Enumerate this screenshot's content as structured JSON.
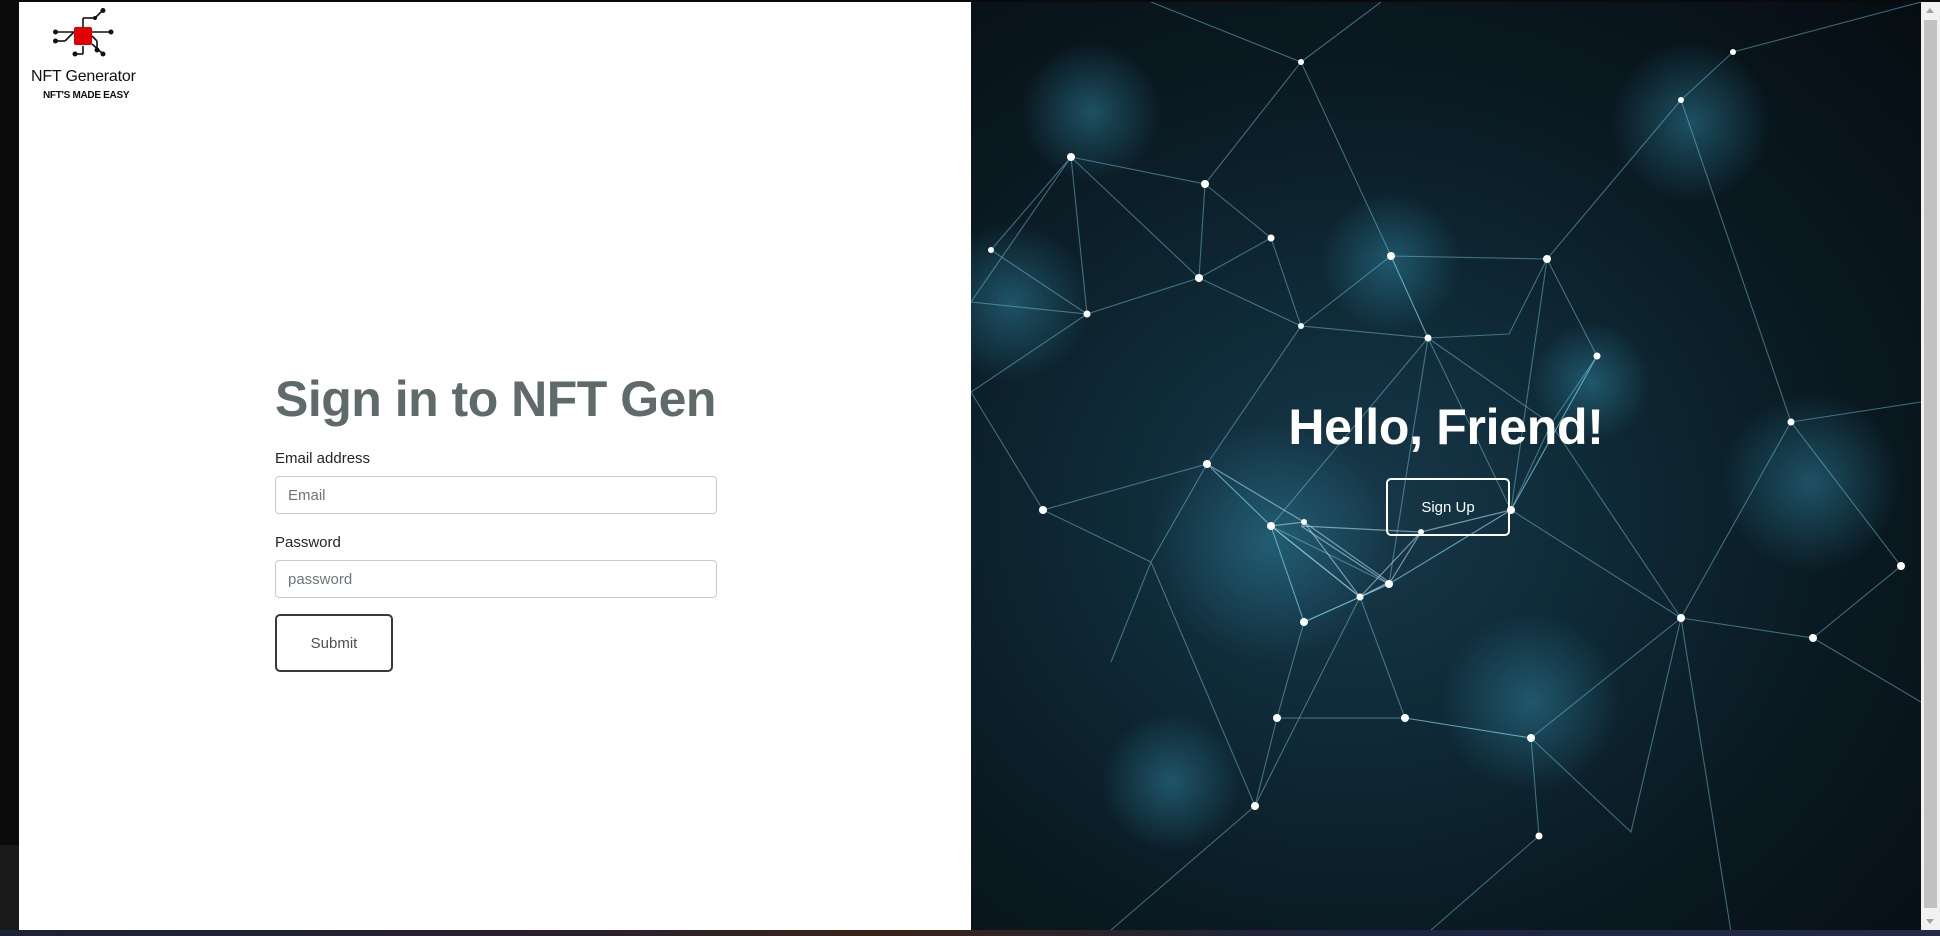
{
  "logo": {
    "title": "NFT Generator",
    "tagline": "NFT'S MADE EASY",
    "accent_color": "#e00000"
  },
  "signin": {
    "title": "Sign in to NFT Gen",
    "email_label": "Email address",
    "email_placeholder": "Email",
    "email_value": "",
    "password_label": "Password",
    "password_placeholder": "password",
    "password_value": "",
    "submit_label": "Submit"
  },
  "hero": {
    "title": "Hello, Friend!",
    "signup_label": "Sign Up"
  },
  "colors": {
    "title_gray": "#5f6a6a",
    "hero_background": "#0f2a37",
    "network_lines": "#7fd0e8"
  }
}
